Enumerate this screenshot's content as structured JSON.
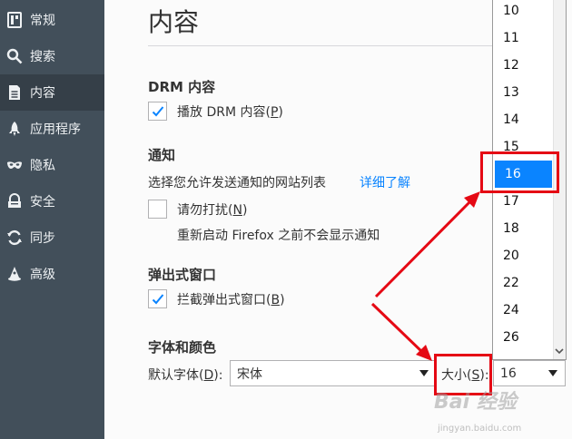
{
  "sidebar": {
    "items": [
      {
        "label": "常规",
        "icon": "general-icon"
      },
      {
        "label": "搜索",
        "icon": "search-icon"
      },
      {
        "label": "内容",
        "icon": "content-icon"
      },
      {
        "label": "应用程序",
        "icon": "applications-icon"
      },
      {
        "label": "隐私",
        "icon": "privacy-mask-icon"
      },
      {
        "label": "安全",
        "icon": "security-icon"
      },
      {
        "label": "同步",
        "icon": "sync-icon"
      },
      {
        "label": "高级",
        "icon": "advanced-icon"
      }
    ],
    "active_index": 2
  },
  "main": {
    "title": "内容",
    "drm": {
      "heading": "DRM 内容",
      "checkbox_label_pre": "播放 DRM 内容(",
      "checkbox_key": "P",
      "checkbox_label_post": ")",
      "checked": true
    },
    "notifications": {
      "heading": "通知",
      "description": "选择您允许发送通知的网站列表",
      "learn_more": "详细了解",
      "dnd_label_pre": "请勿打扰(",
      "dnd_key": "N",
      "dnd_label_post": ")",
      "dnd_checked": false,
      "dnd_note": "重新启动 Firefox 之前不会显示通知"
    },
    "popups": {
      "heading": "弹出式窗口",
      "checkbox_label_pre": "拦截弹出式窗口(",
      "checkbox_key": "B",
      "checkbox_label_post": ")",
      "checked": true
    },
    "fonts": {
      "heading": "字体和颜色",
      "default_font_label_pre": "默认字体(",
      "default_font_key": "D",
      "default_font_label_post": "):",
      "default_font_value": "宋体",
      "size_label_pre": "大小(",
      "size_key": "S",
      "size_label_post": "):",
      "size_value": "16"
    }
  },
  "size_dropdown": {
    "options": [
      "10",
      "11",
      "12",
      "13",
      "14",
      "15",
      "16",
      "17",
      "18",
      "20",
      "22",
      "24",
      "26"
    ],
    "selected": "16"
  },
  "colors": {
    "sidebar_bg": "#424f5a",
    "sidebar_active": "#353f48",
    "accent": "#0a84ff",
    "annotation_red": "#e50914"
  },
  "watermark": {
    "text": "Bai 经验",
    "subtext": "jingyan.baidu.com"
  }
}
